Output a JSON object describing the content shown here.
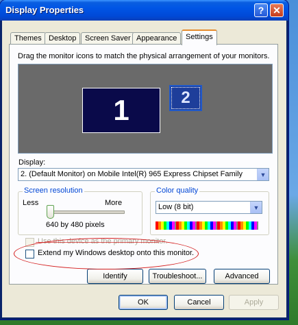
{
  "window": {
    "title": "Display Properties"
  },
  "titlebar_buttons": {
    "help": "?",
    "close": "✕"
  },
  "tabs": [
    "Themes",
    "Desktop",
    "Screen Saver",
    "Appearance",
    "Settings"
  ],
  "instruction": "Drag the monitor icons to match the physical arrangement of your monitors.",
  "monitors": [
    {
      "label": "1"
    },
    {
      "label": "2"
    }
  ],
  "display": {
    "label": "Display:",
    "value": "2. (Default Monitor) on Mobile Intel(R) 965 Express Chipset Family"
  },
  "screen_resolution": {
    "title": "Screen resolution",
    "less": "Less",
    "more": "More",
    "value": "640 by 480 pixels",
    "slider_position": 0
  },
  "color_quality": {
    "title": "Color quality",
    "value": "Low (8 bit)"
  },
  "checkboxes": {
    "primary": {
      "label": "Use this device as the primary monitor.",
      "checked": false,
      "enabled": false
    },
    "extend": {
      "label": "Extend my Windows desktop onto this monitor.",
      "checked": false,
      "enabled": true
    }
  },
  "buttons": {
    "identify": "Identify",
    "troubleshoot": "Troubleshoot...",
    "advanced": "Advanced",
    "ok": "OK",
    "cancel": "Cancel",
    "apply": "Apply"
  },
  "colors": {
    "titlebar": "#0055e5",
    "tab_accent": "#e68b2c",
    "annotation": "#d31a1a",
    "group_title": "#0046d5"
  }
}
